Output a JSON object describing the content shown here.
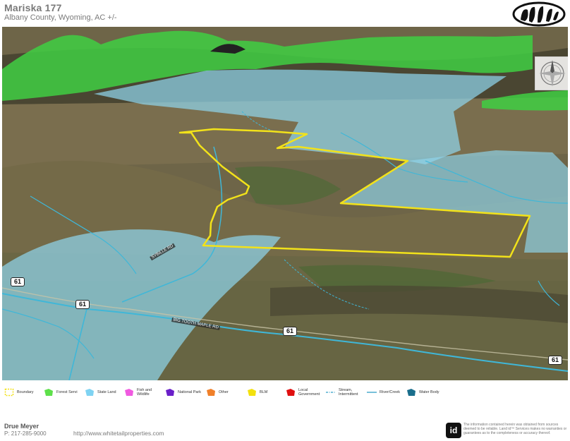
{
  "header": {
    "title": "Mariska 177",
    "subtitle": "Albany County, Wyoming,  AC +/-"
  },
  "map": {
    "roads": [
      {
        "id": "road-61-left",
        "label": "61"
      },
      {
        "id": "road-61-mid",
        "label": "61"
      },
      {
        "id": "road-61-center",
        "label": "61"
      },
      {
        "id": "road-61-right",
        "label": "61"
      }
    ],
    "road_names": [
      {
        "id": "road-name-a",
        "label": "SYBILLE RD"
      },
      {
        "id": "road-name-b",
        "label": "BIG TOOTH MAPLE RD"
      }
    ],
    "colors": {
      "boundary": "#f2e21a",
      "forest_service": "#3fcf43",
      "state_land": "#8fd4ea",
      "stream": "#3fb7d8"
    }
  },
  "legend": [
    {
      "key": "boundary",
      "label": "Boundary",
      "color": "#f2e21a",
      "icon": "boundary-dashed-icon"
    },
    {
      "key": "forest_service",
      "label": "Forest Servi",
      "color": "#5ee04a",
      "icon": "polygon-icon"
    },
    {
      "key": "state_land",
      "label": "State Land",
      "color": "#7fd3f2",
      "icon": "polygon-icon"
    },
    {
      "key": "fish_wildlife",
      "label": "Fish and\nWildlife",
      "color": "#f05ae0",
      "icon": "polygon-icon"
    },
    {
      "key": "national_park",
      "label": "National Park",
      "color": "#6a1fc9",
      "icon": "polygon-icon"
    },
    {
      "key": "other",
      "label": "Other",
      "color": "#f0802a",
      "icon": "polygon-icon"
    },
    {
      "key": "blm",
      "label": "BLM",
      "color": "#f3e10e",
      "icon": "polygon-icon"
    },
    {
      "key": "local_government",
      "label": "Local\nGovernment",
      "color": "#e01010",
      "icon": "polygon-icon"
    },
    {
      "key": "stream_intermittent",
      "label": "Stream,\nIntermittent",
      "color": "#2f9ec7",
      "icon": "dashed-line-icon"
    },
    {
      "key": "river_creek",
      "label": "River/Creek",
      "color": "#2f9ec7",
      "icon": "line-icon"
    },
    {
      "key": "water_body",
      "label": "Water Body",
      "color": "#1a6e8c",
      "icon": "polygon-icon"
    }
  ],
  "footer": {
    "agent_name": "Drue Meyer",
    "phone": "P: 217-285-9000",
    "url": "http://www.whitetailproperties.com",
    "id_logo_text": "id",
    "disclaimer": "The information contained herein was obtained from sources deemed to be reliable. Land id™ Services makes no warranties or guarantees as to the completeness or accuracy thereof."
  }
}
